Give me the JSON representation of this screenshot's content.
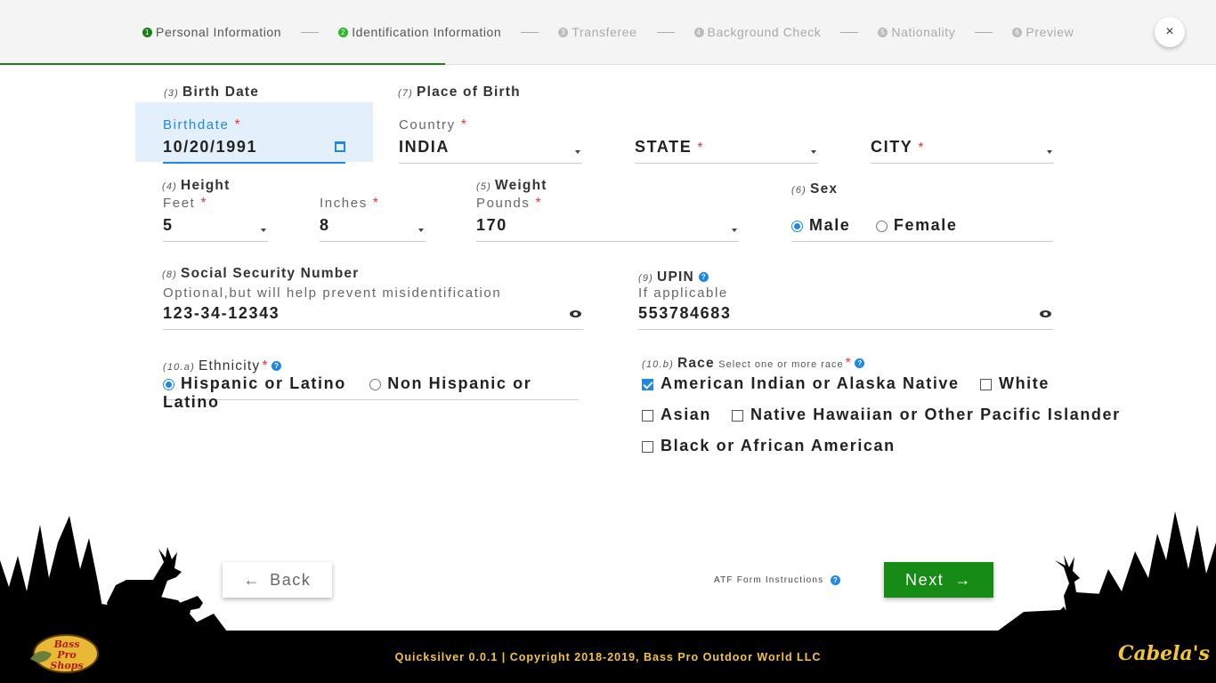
{
  "steps": [
    {
      "num": "1",
      "label": "Personal Information",
      "state": "done"
    },
    {
      "num": "2",
      "label": "Identification Information",
      "state": "active"
    },
    {
      "num": "3",
      "label": "Transferee",
      "state": "pending"
    },
    {
      "num": "4",
      "label": "Background Check",
      "state": "pending"
    },
    {
      "num": "5",
      "label": "Nationality",
      "state": "pending"
    },
    {
      "num": "6",
      "label": "Preview",
      "state": "pending"
    }
  ],
  "close_label": "×",
  "birth": {
    "num": "(3)",
    "title": "Birth Date",
    "label": "Birthdate",
    "value": "10/20/1991"
  },
  "place": {
    "num": "(7)",
    "title": "Place of Birth",
    "country_label": "Country",
    "country_value": "INDIA",
    "state_label": "STATE",
    "city_label": "CITY"
  },
  "height": {
    "num": "(4)",
    "title": "Height",
    "feet_label": "Feet",
    "feet_value": "5",
    "inches_label": "Inches",
    "inches_value": "8"
  },
  "weight": {
    "num": "(5)",
    "title": "Weight",
    "pounds_label": "Pounds",
    "pounds_value": "170"
  },
  "sex": {
    "num": "(6)",
    "title": "Sex",
    "options": [
      "Male",
      "Female"
    ],
    "selected": "Male"
  },
  "ssn": {
    "num": "(8)",
    "title": "Social Security Number",
    "hint": "Optional,but will help prevent misidentification",
    "value": "123-34-12343"
  },
  "upin": {
    "num": "(9)",
    "title": "UPIN",
    "hint": "If applicable",
    "value": "553784683"
  },
  "ethnicity": {
    "num": "(10.a)",
    "title": "Ethnicity",
    "options": [
      "Hispanic or Latino",
      "Non Hispanic or Latino"
    ],
    "selected": "Hispanic or Latino"
  },
  "race": {
    "num": "(10.b)",
    "title": "Race",
    "hint": "Select one or more race",
    "options": [
      {
        "label": "American Indian or Alaska Native",
        "checked": true
      },
      {
        "label": "White",
        "checked": false
      },
      {
        "label": "Asian",
        "checked": false
      },
      {
        "label": "Native Hawaiian or Other Pacific Islander",
        "checked": false
      },
      {
        "label": "Black or African American",
        "checked": false
      }
    ]
  },
  "required_mark": "*",
  "help_mark": "?",
  "buttons": {
    "back": "Back",
    "next": "Next",
    "back_arrow": "←",
    "next_arrow": "→"
  },
  "atf_link": "ATF Form Instructions",
  "footer": {
    "copyright": "Quicksilver 0.0.1 | Copyright 2018-2019, Bass Pro Outdoor World LLC",
    "logo_left": "Bass Pro Shops",
    "logo_right": "Cabela's"
  },
  "colors": {
    "accent_green": "#168b16",
    "accent_blue": "#1e88e5",
    "required_red": "#e53935",
    "footer_gold": "#f2c53d"
  }
}
